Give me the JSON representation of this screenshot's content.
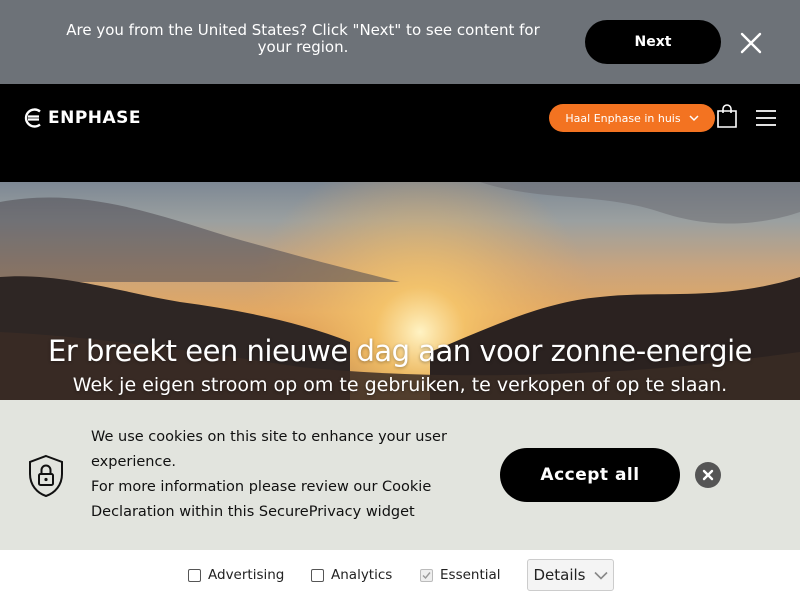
{
  "region_bar": {
    "message": "Are you from the United States? Click \"Next\" to see content for your region.",
    "next_label": "Next",
    "close_icon": "close-icon",
    "background": "#6d7278"
  },
  "header": {
    "logo_text": "ENPHASE",
    "cta_label": "Haal Enphase in huis",
    "cta_color": "#f37321",
    "icons": [
      "chevron-down-icon",
      "shopping-bag-icon",
      "hamburger-menu-icon"
    ]
  },
  "hero": {
    "title": "Er breekt een nieuwe dag aan voor zonne-energie",
    "subtitle": "Wek je eigen stroom op om te gebruiken, te verkopen of op te slaan."
  },
  "cookie_banner": {
    "line1": "We use cookies on this site to enhance your user",
    "line2": "experience.",
    "line3": "For more information please review our Cookie",
    "line4": "Declaration within this SecurePrivacy widget",
    "accept_label": "Accept all",
    "icons": [
      "shield-lock-icon",
      "close-circle-icon"
    ],
    "background": "#e2e4de"
  },
  "consent": {
    "options": [
      {
        "label": "Advertising",
        "checked": false
      },
      {
        "label": "Analytics",
        "checked": false
      },
      {
        "label": "Essential",
        "checked": true
      }
    ],
    "details_label": "Details"
  }
}
